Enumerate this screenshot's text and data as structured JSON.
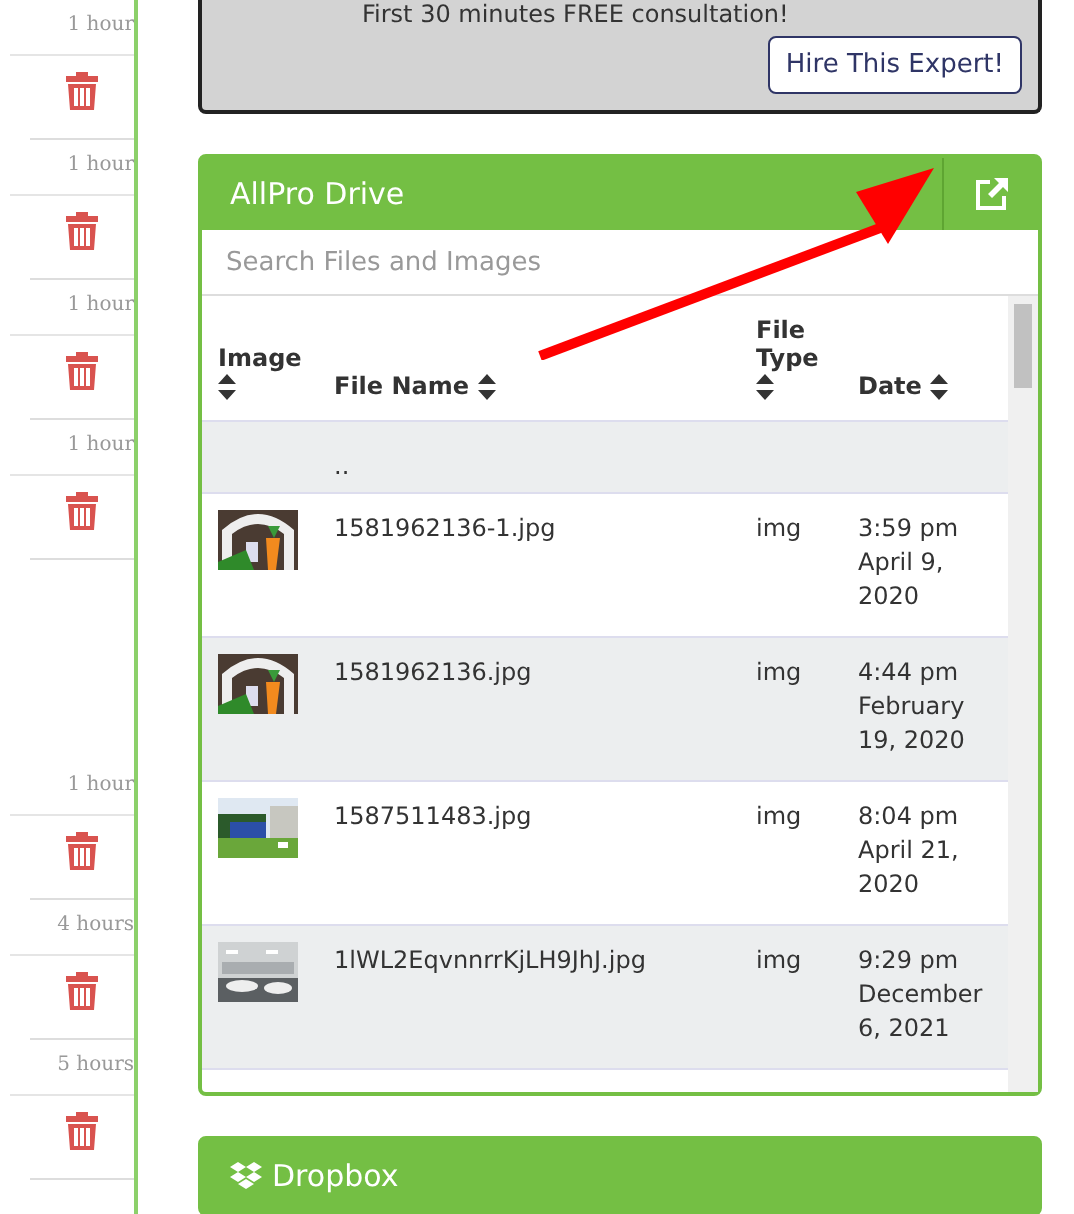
{
  "activity": [
    {
      "time": "1 hour"
    },
    {
      "time": "1 hour"
    },
    {
      "time": "1 hour"
    },
    {
      "time": "1 hour"
    },
    {
      "time": "1 hour"
    },
    {
      "time": "4 hours"
    },
    {
      "time": "5 hours"
    }
  ],
  "expert": {
    "text": "First 30 minutes FREE consultation!",
    "button": "Hire This Expert!"
  },
  "drive": {
    "title": "AllPro Drive",
    "search": {
      "placeholder": "Search Files and Images"
    },
    "columns": [
      "Image",
      "File Name",
      "File Type",
      "Date"
    ],
    "parent": "..",
    "rows": [
      {
        "name": "1581962136-1.jpg",
        "type": "img",
        "date": "3:59 pm April 9, 2020"
      },
      {
        "name": "1581962136.jpg",
        "type": "img",
        "date": "4:44 pm February 19, 2020"
      },
      {
        "name": "1587511483.jpg",
        "type": "img",
        "date": "8:04 pm April 21, 2020"
      },
      {
        "name": "1lWL2EqvnnrrKjLH9JhJ.jpg",
        "type": "img",
        "date": "9:29 pm December 6, 2021"
      }
    ]
  },
  "dropbox": {
    "title": "Dropbox"
  }
}
